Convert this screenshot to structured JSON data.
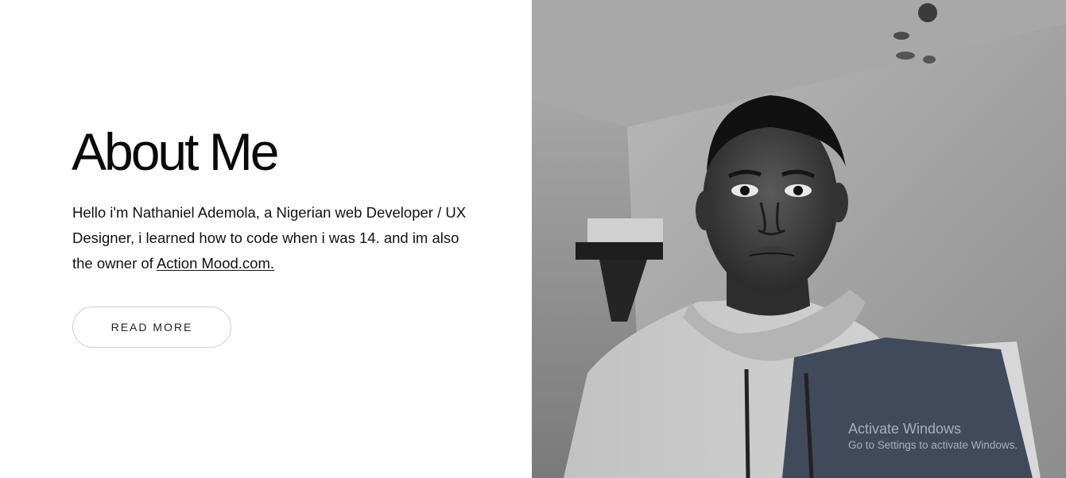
{
  "about": {
    "title": "About Me",
    "bio_text": "Hello i'm Nathaniel Ademola, a Nigerian web Developer / UX Designer, i learned how to code when i was 14. and im also the owner of ",
    "bio_link": "Action Mood.com.",
    "read_more_label": "READ MORE"
  },
  "watermark": {
    "title": "Activate Windows",
    "subtitle": "Go to Settings to activate Windows."
  }
}
